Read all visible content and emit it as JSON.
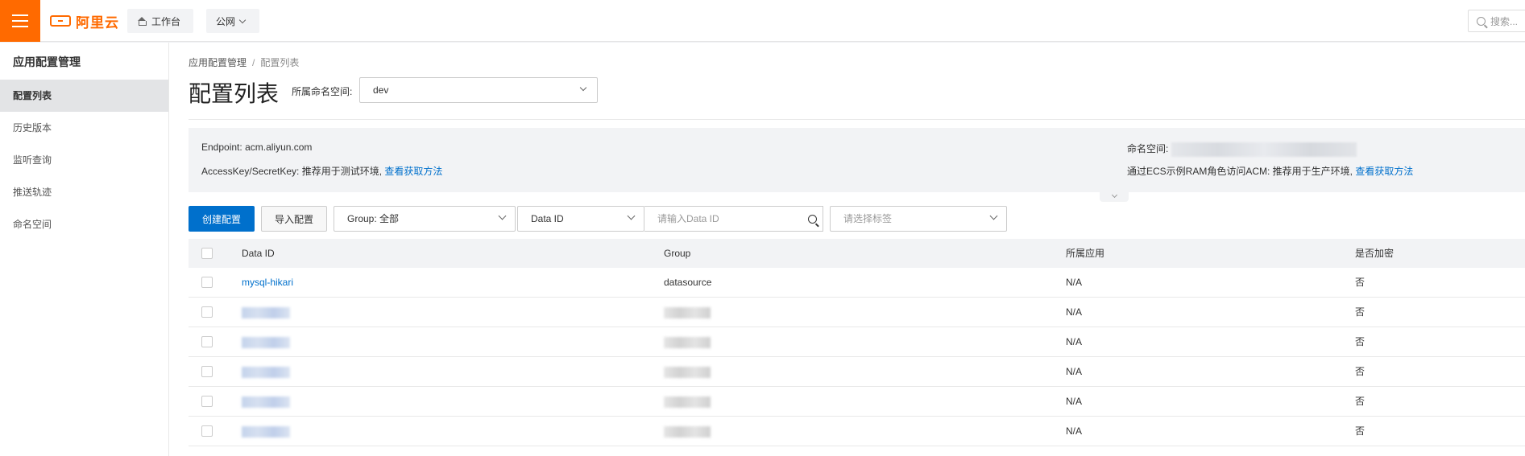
{
  "topbar": {
    "logo_text": "阿里云",
    "workbench_label": "工作台",
    "region_label": "公网",
    "search_placeholder": "搜索..."
  },
  "sidebar": {
    "title": "应用配置管理",
    "items": [
      {
        "label": "配置列表",
        "active": true
      },
      {
        "label": "历史版本",
        "active": false
      },
      {
        "label": "监听查询",
        "active": false
      },
      {
        "label": "推送轨迹",
        "active": false
      },
      {
        "label": "命名空间",
        "active": false
      }
    ]
  },
  "breadcrumb": {
    "parent": "应用配置管理",
    "separator": "/",
    "current": "配置列表"
  },
  "page": {
    "title": "配置列表",
    "namespace_label": "所属命名空间:",
    "namespace_value": "dev"
  },
  "info": {
    "endpoint_label": "Endpoint:",
    "endpoint_value": "acm.aliyun.com",
    "accesskey_text": "AccessKey/SecretKey: 推荐用于测试环境,",
    "accesskey_link": "查看获取方法",
    "namespace_id_label": "命名空间:",
    "ecs_text": "通过ECS示例RAM角色访问ACM: 推荐用于生产环境,",
    "ecs_link": "查看获取方法"
  },
  "toolbar": {
    "create_label": "创建配置",
    "import_label": "导入配置",
    "group_select": "Group: 全部",
    "dataid_select": "Data ID",
    "dataid_placeholder": "请输入Data ID",
    "tags_placeholder": "请选择标签"
  },
  "table": {
    "headers": {
      "data_id": "Data ID",
      "group": "Group",
      "app": "所属应用",
      "encrypted": "是否加密"
    },
    "rows": [
      {
        "data_id": "mysql-hikari",
        "group": "datasource",
        "app": "N/A",
        "encrypted": "否"
      },
      {
        "data_id": "",
        "group": "",
        "app": "N/A",
        "encrypted": "否"
      },
      {
        "data_id": "",
        "group": "",
        "app": "N/A",
        "encrypted": "否"
      },
      {
        "data_id": "",
        "group": "",
        "app": "N/A",
        "encrypted": "否"
      },
      {
        "data_id": "",
        "group": "",
        "app": "N/A",
        "encrypted": "否"
      },
      {
        "data_id": "",
        "group": "",
        "app": "N/A",
        "encrypted": "否"
      }
    ]
  },
  "colors": {
    "brand": "#ff6a00",
    "primary": "#0070cc",
    "panel": "#f2f3f5"
  },
  "icons": [
    "menu-icon",
    "aliyun-logo-icon",
    "home-icon",
    "chevron-down-icon",
    "search-icon",
    "checkbox-icon"
  ]
}
